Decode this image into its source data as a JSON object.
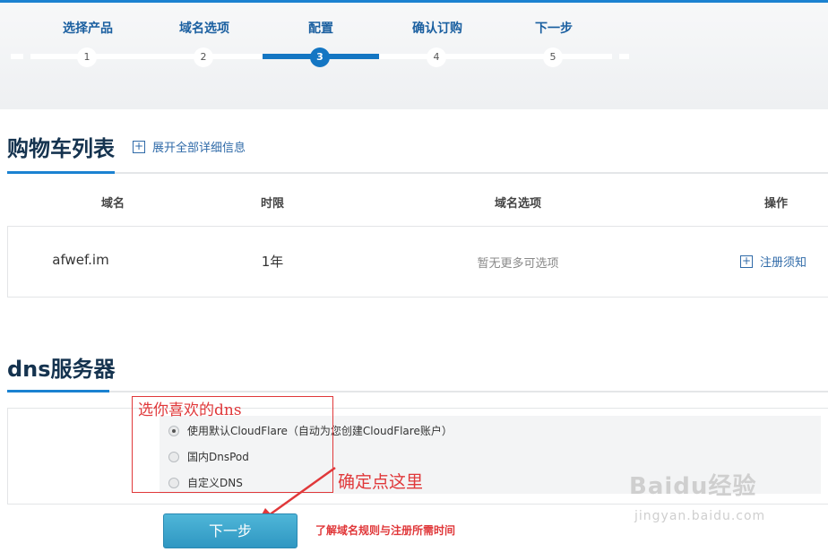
{
  "steps": [
    {
      "label": "选择产品",
      "num": "1"
    },
    {
      "label": "域名选项",
      "num": "2"
    },
    {
      "label": "配置",
      "num": "3"
    },
    {
      "label": "确认订购",
      "num": "4"
    },
    {
      "label": "下一步",
      "num": "5"
    }
  ],
  "current_step": 3,
  "cart": {
    "title": "购物车列表",
    "expand_link": "展开全部详细信息",
    "columns": [
      "域名",
      "时限",
      "域名选项",
      "操作"
    ],
    "rows": [
      {
        "domain": "afwef.im",
        "term": "1年",
        "options": "暂无更多可选项",
        "action": "注册须知"
      }
    ]
  },
  "dns": {
    "title": "dns服务器",
    "options": [
      {
        "label": "使用默认CloudFlare（自动为您创建CloudFlare账户）",
        "checked": true
      },
      {
        "label": "国内DnsPod",
        "checked": false
      },
      {
        "label": "自定义DNS",
        "checked": false
      }
    ]
  },
  "next_button": "下一步",
  "rules_link": "了解域名规则与注册所需时间",
  "annotations": {
    "choose_dns": "选你喜欢的dns",
    "click_here": "确定点这里"
  },
  "watermark": {
    "main": "Baidu经验",
    "sub": "jingyan.baidu.com"
  },
  "colors": {
    "accent": "#1476c3",
    "annotation": "#e0383a",
    "button": "#3aa6cf"
  }
}
